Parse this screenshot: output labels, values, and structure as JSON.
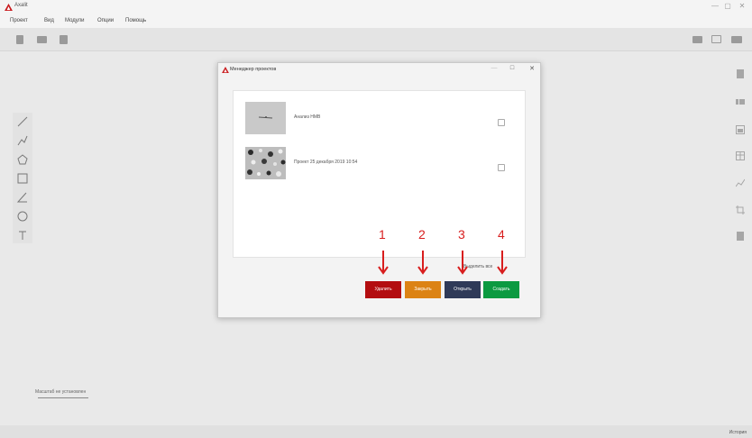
{
  "app": {
    "title": "Axalit",
    "window_controls": {
      "minimize": "—",
      "maximize": "▢",
      "close": "✕"
    }
  },
  "menu": {
    "items": [
      "Проект",
      "Вид",
      "Модули",
      "Опции",
      "Помощь"
    ]
  },
  "toolbar": {
    "left_icons": [
      "new-file-icon",
      "open-folder-icon",
      "copy-icon"
    ],
    "right_icons": [
      "camera-icon",
      "image-icon",
      "video-icon"
    ]
  },
  "left_tools": [
    "line-tool-icon",
    "polyline-tool-icon",
    "polygon-tool-icon",
    "rectangle-tool-icon",
    "angle-tool-icon",
    "circle-tool-icon",
    "text-tool-icon"
  ],
  "right_tools": [
    "panel-1-icon",
    "panel-2-icon",
    "panel-3-icon",
    "table-icon",
    "chart-icon",
    "crop-icon",
    "report-icon"
  ],
  "scale_label": "Масштаб не установлен",
  "status": {
    "text": "История"
  },
  "dialog": {
    "title": "Менеджер проектов",
    "controls": {
      "minimize": "—",
      "maximize": "□",
      "close": "✕"
    },
    "projects": [
      {
        "name": "Анализ НМВ",
        "checked": false
      },
      {
        "name": "Проект 25 декабря 2019 10:54",
        "checked": false
      }
    ],
    "select_all": "Выделить все",
    "buttons": {
      "delete": "Удалить",
      "close": "Закрыть",
      "open": "Открыть",
      "create": "Создать"
    }
  },
  "annotations": {
    "numbers": [
      "1",
      "2",
      "3",
      "4"
    ],
    "color": "#d81e1e"
  },
  "colors": {
    "delete": "#b30d10",
    "close": "#dc8314",
    "open": "#2f3a58",
    "create": "#0c9a41"
  }
}
